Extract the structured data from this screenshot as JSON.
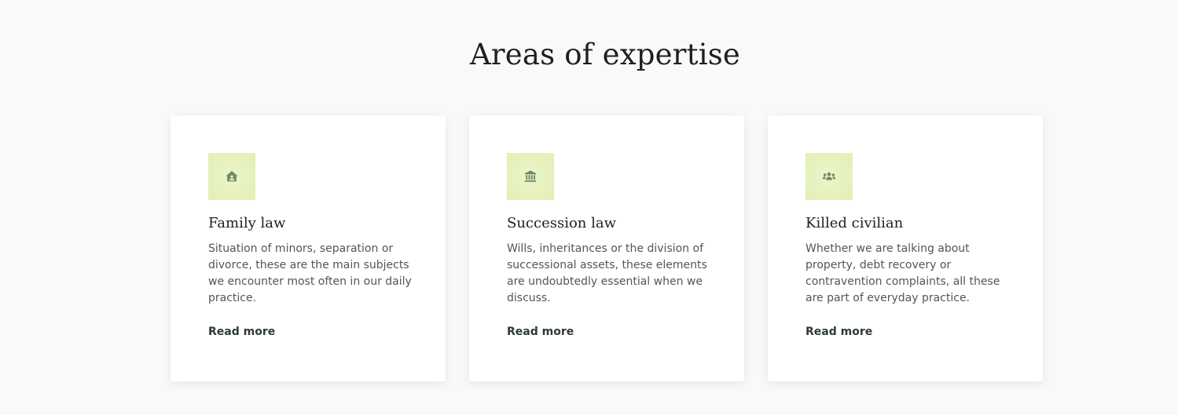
{
  "section": {
    "title": "Areas of expertise"
  },
  "colors": {
    "background": "#f9f9fb",
    "card": "#ffffff",
    "icon_bg": "#e4f0ba",
    "icon_fg": "#6f8a66",
    "link": "#2e3a37"
  },
  "cards": [
    {
      "icon": "house-icon",
      "title": "Family law",
      "text": "Situation of minors, separation or divorce, these are the main subjects we encounter most often in our daily practice.",
      "link": "Read more"
    },
    {
      "icon": "bank-building-icon",
      "title": "Succession law",
      "text": "Wills, inheritances or the division of successional assets, these elements are undoubtedly essential when we discuss.",
      "link": "Read more"
    },
    {
      "icon": "people-group-icon",
      "title": "Killed civilian",
      "text": "Whether we are talking about property, debt recovery or contravention complaints, all these are part of everyday practice.",
      "link": "Read more"
    }
  ]
}
